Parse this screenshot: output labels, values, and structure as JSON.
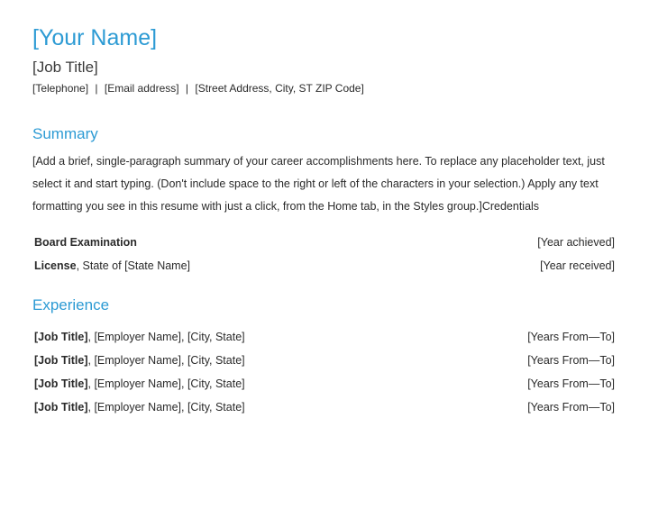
{
  "header": {
    "name": "[Your Name]",
    "job_title": "[Job Title]",
    "telephone": "[Telephone]",
    "email": "[Email address]",
    "address": "[Street Address, City, ST ZIP Code]",
    "sep": "|"
  },
  "summary": {
    "heading": "Summary",
    "body": "[Add a brief, single-paragraph summary of your career accomplishments here. To replace any placeholder text, just select it and start typing. (Don't include space to the right or left of the characters in your selection.) Apply any text formatting you see in this resume with just a click, from the Home tab, in the Styles group.]Credentials"
  },
  "credentials": [
    {
      "label_bold": "Board Examination",
      "label_rest": "",
      "right": "[Year achieved]"
    },
    {
      "label_bold": "License",
      "label_rest": ", State of [State Name]",
      "right": "[Year received]"
    }
  ],
  "experience": {
    "heading": "Experience",
    "items": [
      {
        "title": "[Job Title]",
        "rest": ", [Employer Name], [City, State]",
        "years": "[Years From—To]"
      },
      {
        "title": "[Job Title]",
        "rest": ", [Employer Name], [City, State]",
        "years": "[Years From—To]"
      },
      {
        "title": "[Job Title]",
        "rest": ", [Employer Name], [City, State]",
        "years": "[Years From—To]"
      },
      {
        "title": "[Job Title]",
        "rest": ", [Employer Name], [City, State]",
        "years": "[Years From—To]"
      }
    ]
  }
}
